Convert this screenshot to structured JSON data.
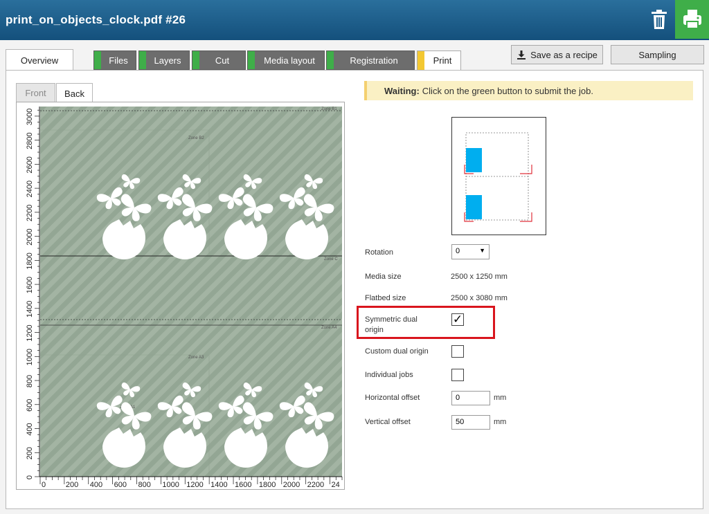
{
  "header": {
    "title": "print_on_objects_clock.pdf #26"
  },
  "tabs": [
    {
      "label": "Overview",
      "status": "active"
    },
    {
      "label": "Files",
      "status": "#3fae49"
    },
    {
      "label": "Layers",
      "status": "#3fae49"
    },
    {
      "label": "Cut",
      "status": "#3fae49"
    },
    {
      "label": "Media layout",
      "status": "#3fae49"
    },
    {
      "label": "Registration",
      "status": "#3fae49"
    },
    {
      "label": "Print",
      "status": "#f3c832"
    }
  ],
  "actions": {
    "save_recipe": "Save as a recipe",
    "sampling": "Sampling"
  },
  "view_tabs": {
    "front": "Front",
    "back": "Back"
  },
  "preview": {
    "y_ticks": [
      "0",
      "200",
      "400",
      "600",
      "800",
      "1000",
      "1200",
      "1400",
      "1600",
      "1800",
      "2000",
      "2200",
      "2400",
      "2600",
      "2800",
      "3000"
    ],
    "x_ticks": [
      "0",
      "200",
      "400",
      "600",
      "800",
      "1000",
      "1200",
      "1400",
      "1600",
      "1800",
      "2000",
      "2200",
      "24"
    ],
    "zones": {
      "top_right": "Zone B1",
      "b2": "Zone B2",
      "mid_right": "Zone C",
      "a_right": "Zone A4",
      "a3": "Zone A3",
      "a1": "Zone A1"
    }
  },
  "status": {
    "strong": "Waiting:",
    "text": "Click on the green button to submit the job."
  },
  "settings": {
    "rotation_label": "Rotation",
    "rotation_value": "0",
    "media_size_label": "Media size",
    "media_size_value": "2500 x 1250 mm",
    "flatbed_size_label": "Flatbed size",
    "flatbed_size_value": "2500 x 3080 mm",
    "symmetric_label": "Symmetric dual origin",
    "custom_label": "Custom dual origin",
    "individual_label": "Individual jobs",
    "h_offset_label": "Horizontal offset",
    "h_offset_value": "0",
    "v_offset_label": "Vertical offset",
    "v_offset_value": "50",
    "unit": "mm"
  },
  "colors": {
    "header": "#1a5c8a",
    "print_button": "#3fae49",
    "accent_tab": "#f3c832",
    "highlight": "#d9151d",
    "media_blue": "#00aeef",
    "media_green": "#9aad9b"
  }
}
